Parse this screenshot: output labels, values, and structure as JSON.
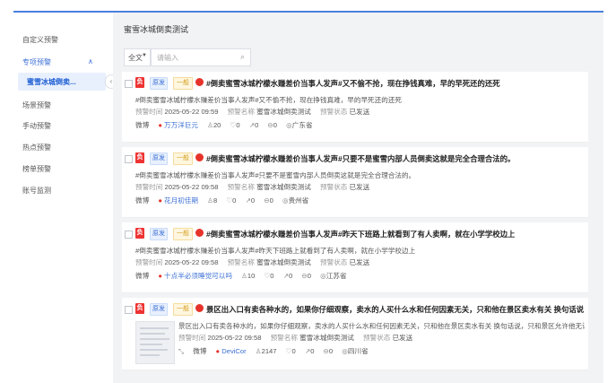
{
  "sidebar": {
    "items": [
      {
        "label": "自定义预警"
      },
      {
        "label": "专项预警",
        "expanded": true
      },
      {
        "label": "蜜雪冰城倒卖...",
        "active": true
      },
      {
        "label": "场景预警"
      },
      {
        "label": "手动预警"
      },
      {
        "label": "热点预警"
      },
      {
        "label": "榜单预警"
      },
      {
        "label": "账号监测"
      }
    ],
    "collapse_icon": "chevron-left-icon"
  },
  "main": {
    "title": "蜜雪冰城倒卖测试",
    "search": {
      "scope": "全文",
      "placeholder": "请输入"
    }
  },
  "labels": {
    "time_key": "预警时间",
    "name_key": "预警名称",
    "status_key": "预警状态"
  },
  "cards": [
    {
      "neg": "负",
      "type": "原发",
      "level": "一般",
      "title": "#倒卖蜜雪冰城柠檬水赚差价当事人发声#又不偷不抢，现在挣钱真难，早的早死还的还死",
      "excerpt": "#倒卖蜜雪冰城柠檬水赚差价当事人发声#又不偷不抢，现在挣钱真难，早的早死还的还死",
      "time": "2025-05-22 09:59",
      "name": "蜜雪冰城倒卖测试",
      "status": "已发送",
      "platform": "微博",
      "author": "万万洋巨元",
      "followers": "20",
      "likes": "0",
      "reposts": "0",
      "comments": "0",
      "location": "广东省"
    },
    {
      "neg": "负",
      "type": "原发",
      "level": "一般",
      "title": "#倒卖蜜雪冰城柠檬水赚差价当事人发声#只要不是蜜雪内部人员倒卖这就是完全合理合法的。",
      "excerpt": "#倒卖蜜雪冰城柠檬水赚差价当事人发声#只要不是蜜雪内部人员倒卖这就是完全合理合法的。",
      "time": "2025-05-22 09:58",
      "name": "蜜雪冰城倒卖测试",
      "status": "已发送",
      "platform": "微博",
      "author": "花月初佳期",
      "followers": "8",
      "likes": "0",
      "reposts": "0",
      "comments": "0",
      "location": "贵州省"
    },
    {
      "neg": "负",
      "type": "原发",
      "level": "一般",
      "title": "#倒卖蜜雪冰城柠檬水赚差价当事人发声#昨天下班路上就看到了有人卖啊，就在小学学校边上",
      "excerpt": "#倒卖蜜雪冰城柠檬水赚差价当事人发声#昨天下班路上就看到了有人卖啊，就在小学学校边上",
      "time": "2025-05-22 09:58",
      "name": "蜜雪冰城倒卖测试",
      "status": "已发送",
      "platform": "微博",
      "author": "十点半必须睡觉可以吗",
      "followers": "10",
      "likes": "0",
      "reposts": "0",
      "comments": "0",
      "location": "江苏省"
    },
    {
      "neg": "负",
      "type": "原发",
      "level": "一般",
      "title": "景区出入口有卖各种水的，如果你仔细观察，卖水的人买什么水和任何因素无关，只和他在景区卖水有关 换句话说，只和景区允许他",
      "excerpt": "景区出入口有卖各种水的，如果你仔细观察，卖水的人买什么水和任何因素无关，只和他在景区卖水有关 换句话说，只和景区允许他无证卖水有关，你要",
      "time": "2025-05-22 09:58",
      "name": "蜜雪冰城倒卖测试",
      "status": "已发送",
      "platform": "微博",
      "author": "DeviCor",
      "followers": "2147",
      "likes": "0",
      "reposts": "0",
      "comments": "0",
      "location": "四川省"
    }
  ],
  "colors": {
    "accent": "#3b6fd6",
    "negative": "#e33333",
    "weibo": "#e6332a",
    "topbar": "#4a7fe0"
  }
}
